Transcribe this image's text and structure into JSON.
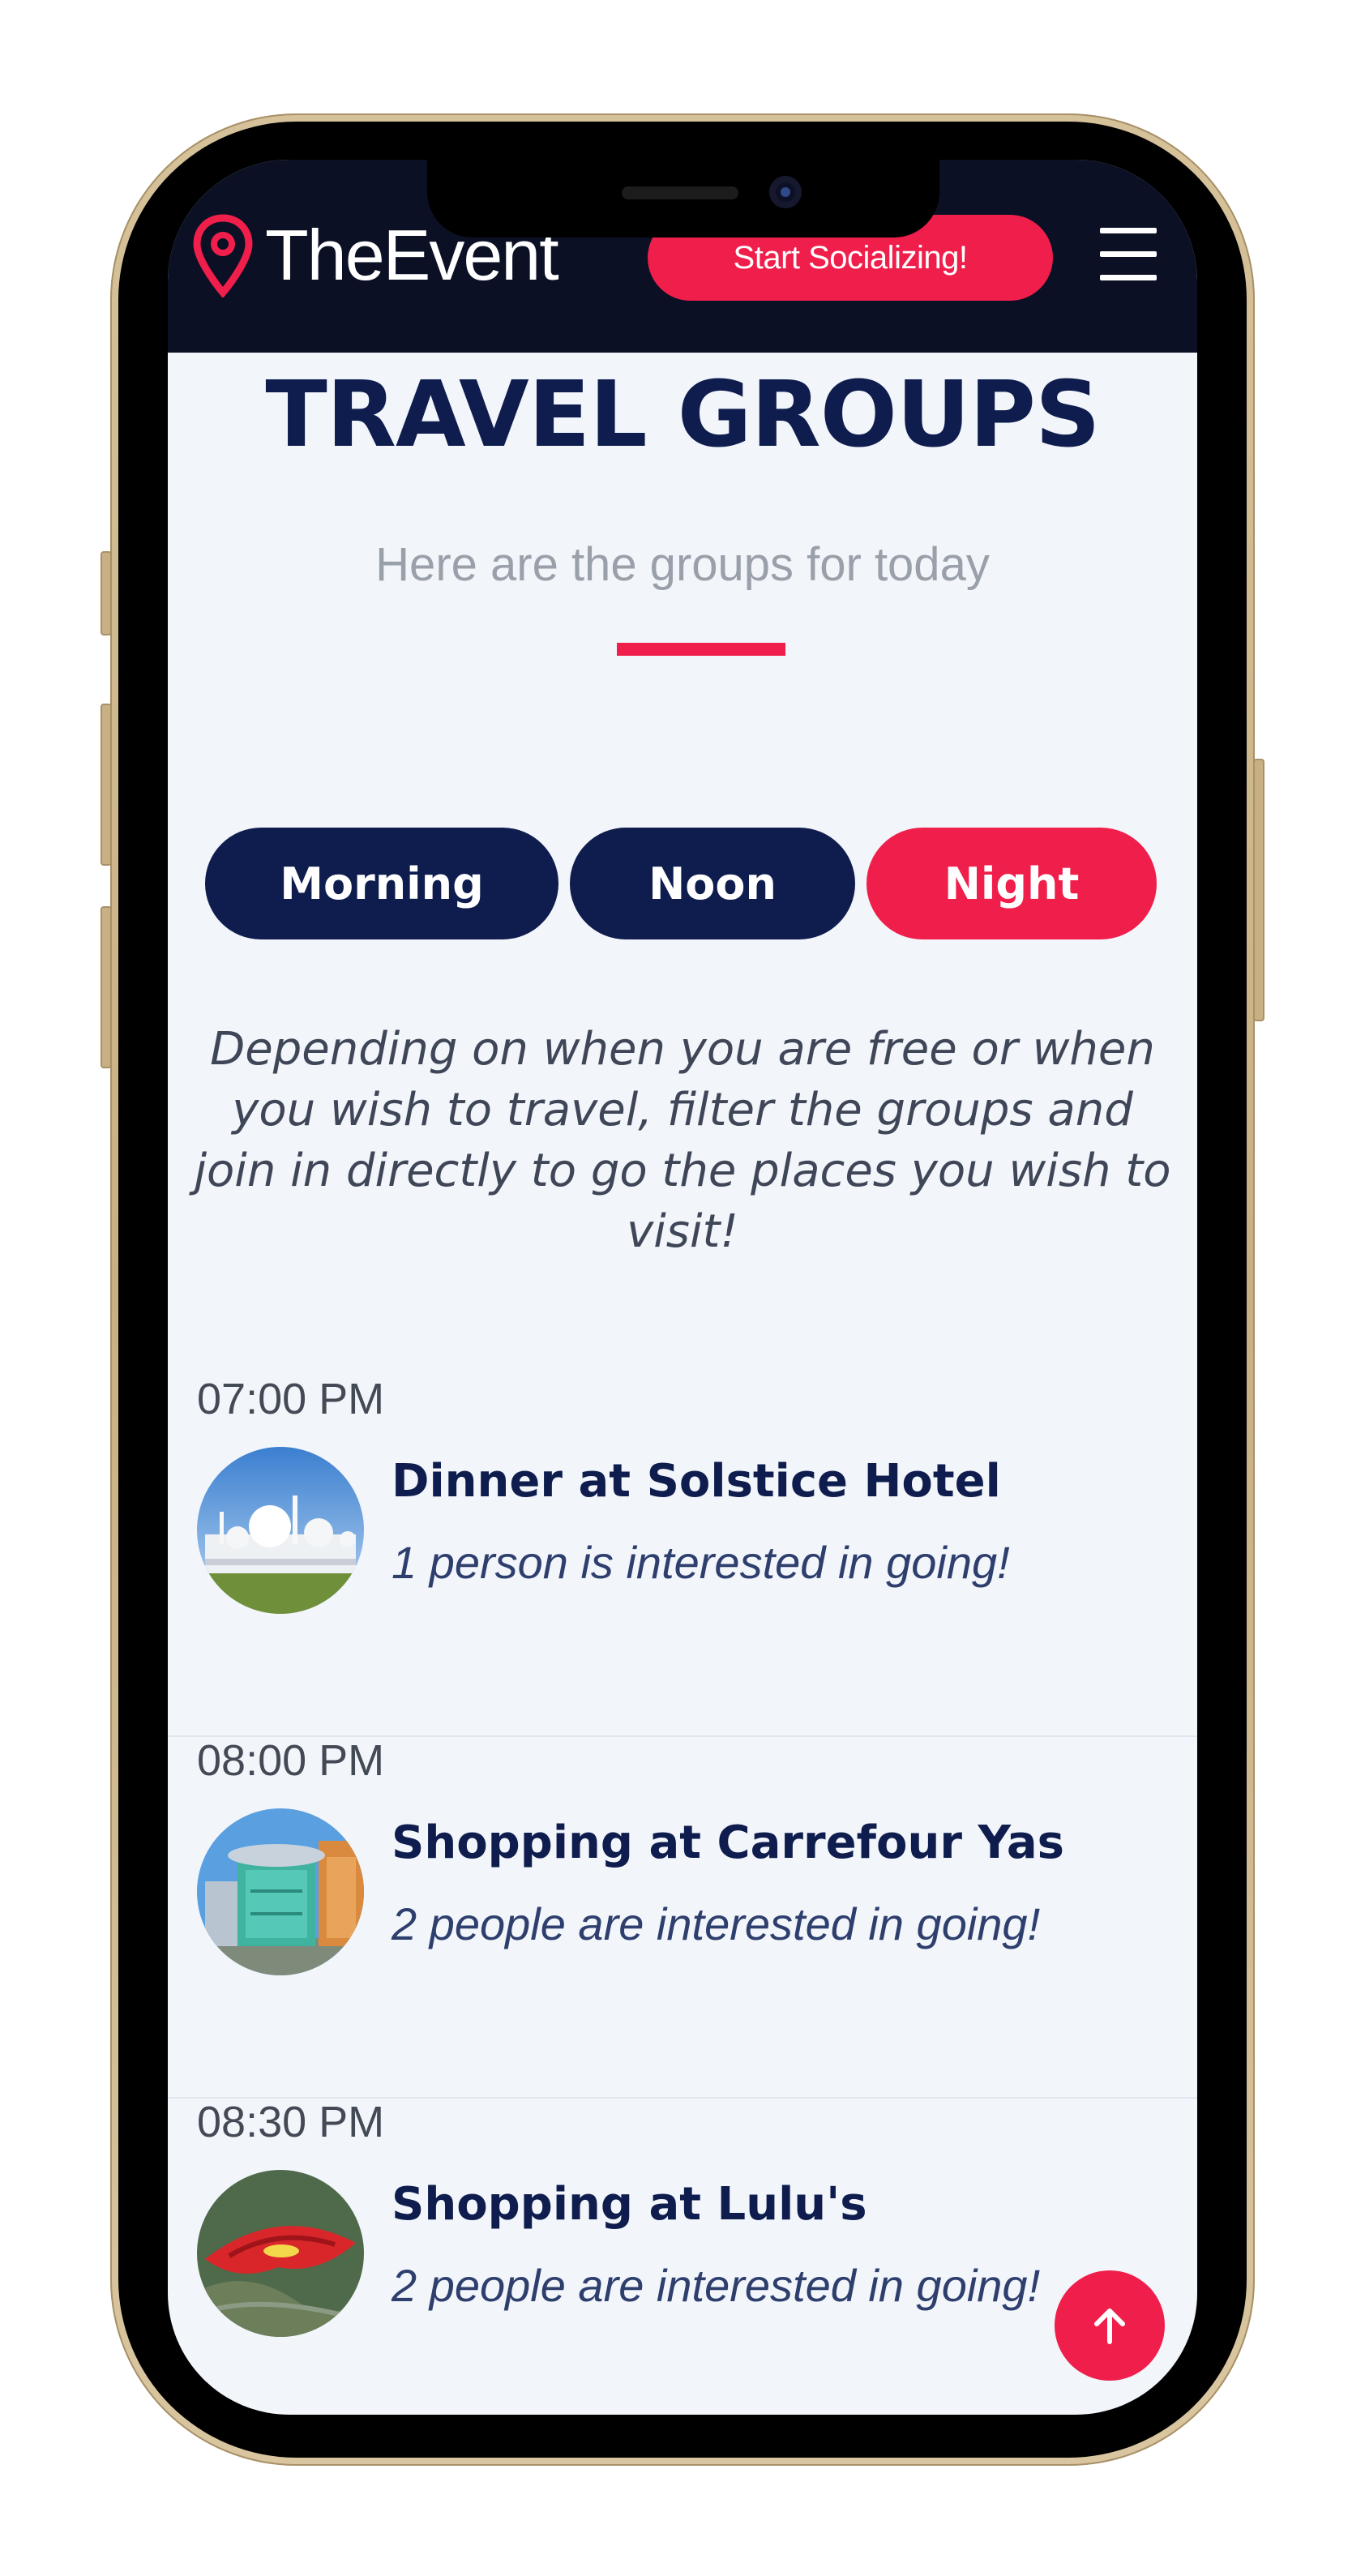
{
  "header": {
    "logo_text": "TheEvent",
    "cta_label": "Start Socializing!"
  },
  "section": {
    "title": "TRAVEL GROUPS",
    "subtitle": "Here are the groups for today"
  },
  "filters": [
    {
      "label": "Morning",
      "active": false
    },
    {
      "label": "Noon",
      "active": false
    },
    {
      "label": "Night",
      "active": true
    }
  ],
  "intro": "Depending on when you are free or when you wish to travel, filter the groups and join in directly to go the places you wish to visit!",
  "groups": [
    {
      "time": "07:00 PM",
      "name": "Dinner at Solstice Hotel",
      "interest": "1 person is interested in going!",
      "image": "mosque-image"
    },
    {
      "time": "08:00 PM",
      "name": "Shopping at Carrefour Yas",
      "interest": "2 people are interested in going!",
      "image": "mall-image"
    },
    {
      "time": "08:30 PM",
      "name": "Shopping at Lulu's",
      "interest": "2 people are interested in going!",
      "image": "ferrari-world-image"
    }
  ],
  "colors": {
    "navy": "#0e1d4e",
    "header_bg": "#0b1024",
    "accent": "#f01e4b",
    "screen_bg": "#f2f5fa"
  },
  "icons": {
    "logo": "map-pin-icon",
    "menu": "hamburger-menu-icon",
    "scroll_top": "arrow-up-icon"
  }
}
